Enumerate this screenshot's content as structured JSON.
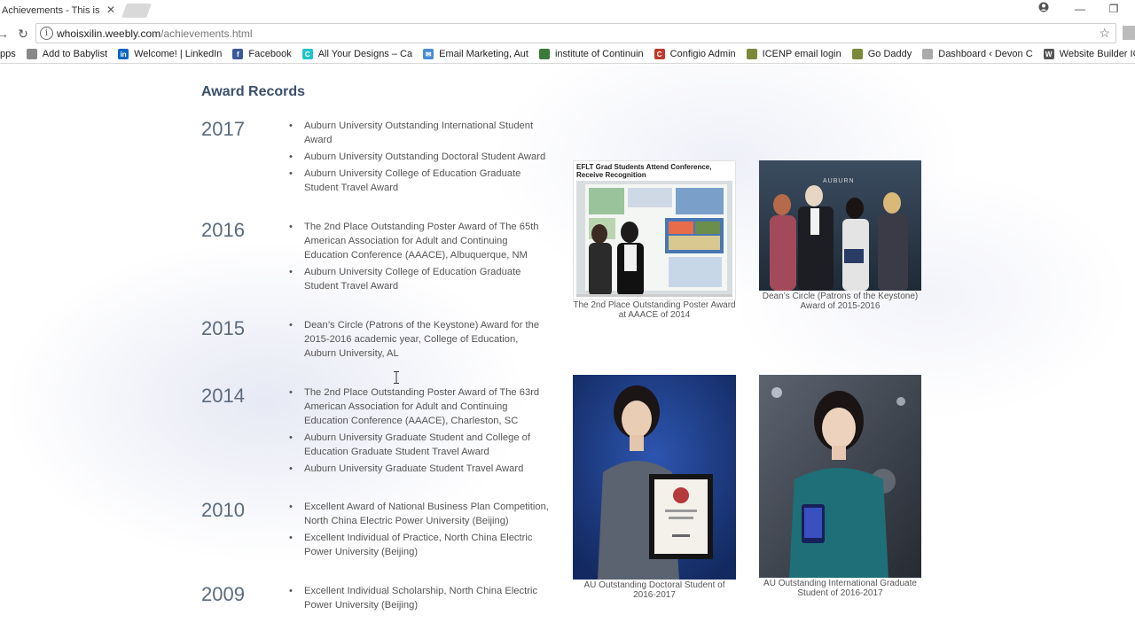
{
  "browser": {
    "tab_title": "Achievements - This is XI",
    "url_domain": "whoisxilin.weebly.com",
    "url_path": "/achievements.html",
    "bookmarks": [
      {
        "label": "pps",
        "icon": "apps-icon",
        "color": "#4a74c9"
      },
      {
        "label": "Add to Babylist",
        "icon": "page-icon",
        "color": "#888888"
      },
      {
        "label": "Welcome! | LinkedIn",
        "icon": "linkedin-icon",
        "color": "#0a66c2"
      },
      {
        "label": "Facebook",
        "icon": "facebook-icon",
        "color": "#3b5998"
      },
      {
        "label": "All Your Designs – Ca",
        "icon": "canva-icon",
        "color": "#20c4cb"
      },
      {
        "label": "Email Marketing, Aut",
        "icon": "mail-icon",
        "color": "#4a8bd6"
      },
      {
        "label": "institute of Continuin",
        "icon": "leaf-icon",
        "color": "#3c7a3c"
      },
      {
        "label": "Configio Admin",
        "icon": "configio-icon",
        "color": "#c0392b"
      },
      {
        "label": "ICENP email login",
        "icon": "icenp-icon",
        "color": "#7a8a3a"
      },
      {
        "label": "Go Daddy",
        "icon": "godaddy-icon",
        "color": "#7a8a3a"
      },
      {
        "label": "Dashboard ‹ Devon C",
        "icon": "wordpress-icon",
        "color": "#aaaaaa"
      },
      {
        "label": "Website Builder ICEN",
        "icon": "weebly-icon",
        "color": "#555555"
      }
    ]
  },
  "page": {
    "heading": "Award Records",
    "records": [
      {
        "year": "2017",
        "awards": [
          "Auburn University Outstanding International Student Award",
          "Auburn University Outstanding Doctoral Student Award",
          "Auburn University College of Education Graduate Student Travel Award"
        ]
      },
      {
        "year": "2016",
        "awards": [
          "The 2nd Place Outstanding Poster Award of The 65th American Association for Adult and Continuing Education Conference (AAACE), Albuquerque, NM",
          "Auburn University College of Education Graduate Student Travel Award"
        ]
      },
      {
        "year": "2015",
        "awards": [
          "Dean’s Circle (Patrons of the Keystone) Award for the 2015-2016 academic year, College of Education, Auburn University, AL"
        ]
      },
      {
        "year": "2014",
        "awards": [
          "The 2nd Place Outstanding Poster Award of The 63rd American Association for Adult and Continuing Education Conference (AAACE), Charleston, SC",
          "Auburn University Graduate Student and College of Education Graduate Student Travel Award",
          "Auburn University Graduate Student Travel Award"
        ]
      },
      {
        "year": "2010",
        "awards": [
          "Excellent Award of National Business Plan Competition, North China Electric Power University (Beijing)",
          "Excellent Individual of Practice, North China Electric Power University (Beijing)"
        ]
      },
      {
        "year": "2009",
        "awards": [
          "Excellent Individual Scholarship, North China Electric Power University (Beijing)"
        ]
      }
    ],
    "photos": [
      {
        "caption": "The 2nd Place Outstanding Poster Award at AAACE of 2014",
        "headline": "EFLT Grad Students Attend Conference, Receive Recognition"
      },
      {
        "caption": "Dean’s Circle (Patrons of the Keystone) Award of 2015-2016",
        "banner": "AUBURN"
      },
      {
        "caption": "AU Outstanding Doctoral Student of 2016-2017"
      },
      {
        "caption": "AU Outstanding International Graduate Student of 2016-2017"
      }
    ]
  }
}
